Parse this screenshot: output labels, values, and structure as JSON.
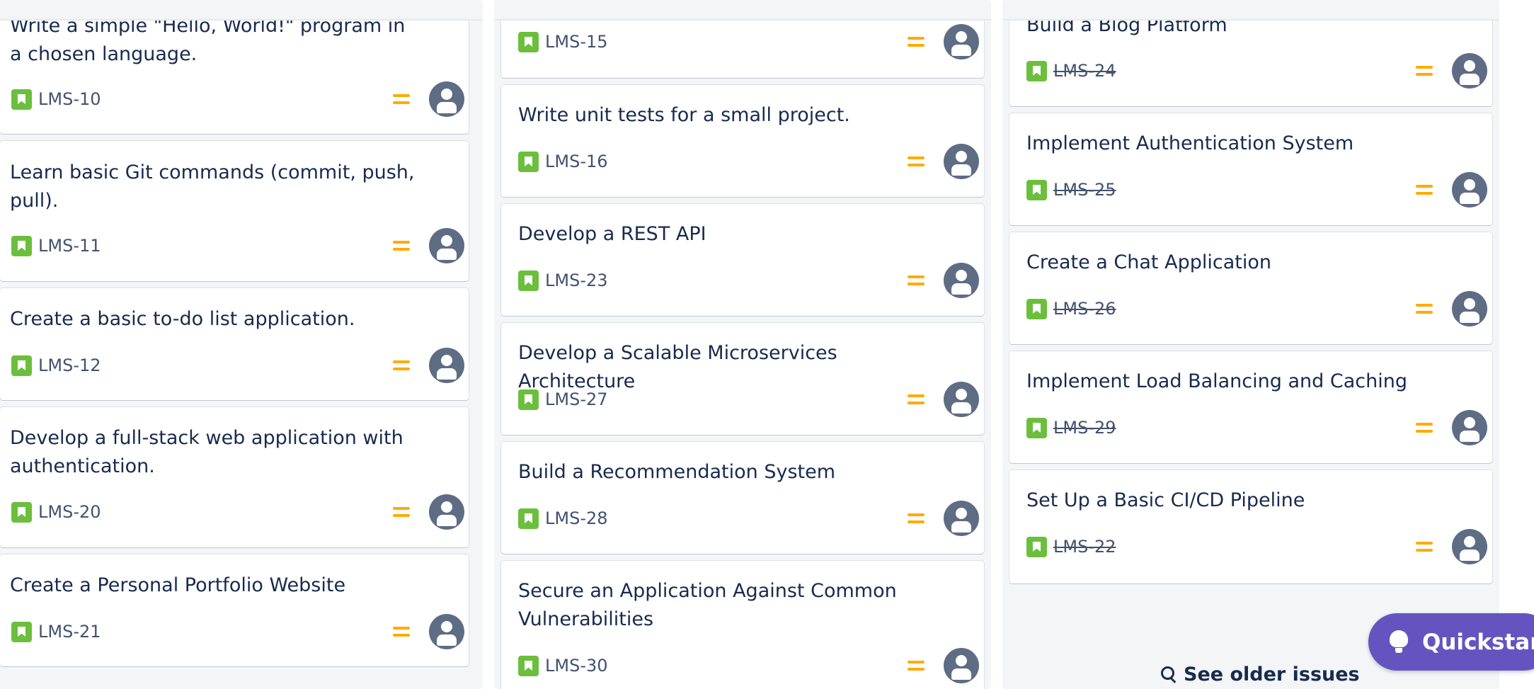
{
  "columns": [
    {
      "cards": [
        {
          "title": "Write a simple \"Hello, World!\" program in a chosen language.",
          "key": "LMS-10"
        },
        {
          "title": "Learn basic Git commands (commit, push, pull).",
          "key": "LMS-11"
        },
        {
          "title": "Create a basic to-do list application.",
          "key": "LMS-12"
        },
        {
          "title": "Develop a full-stack web application with authentication.",
          "key": "LMS-20"
        },
        {
          "title": "Create a Personal Portfolio Website",
          "key": "LMS-21"
        }
      ]
    },
    {
      "cards": [
        {
          "title": "",
          "key": "LMS-15"
        },
        {
          "title": "Write unit tests for a small project.",
          "key": "LMS-16"
        },
        {
          "title": "Develop a REST API",
          "key": "LMS-23"
        },
        {
          "title": "Develop a Scalable Microservices Architecture",
          "key": "LMS-27"
        },
        {
          "title": "Build a Recommendation System",
          "key": "LMS-28"
        },
        {
          "title": "Secure an Application Against Common Vulnerabilities",
          "key": "LMS-30"
        }
      ]
    },
    {
      "cards": [
        {
          "title": "Build a Blog Platform",
          "key": "LMS-24"
        },
        {
          "title": "Implement Authentication System",
          "key": "LMS-25"
        },
        {
          "title": "Create a Chat Application",
          "key": "LMS-26"
        },
        {
          "title": "Implement Load Balancing and Caching",
          "key": "LMS-29"
        },
        {
          "title": "Set Up a Basic CI/CD Pipeline",
          "key": "LMS-22"
        }
      ]
    }
  ],
  "see_older_label": "See older issues",
  "quickstart_label": "Quickstart",
  "colors": {
    "story": "#6bbf3c",
    "priority_medium": "#ffab00",
    "avatar": "#5e6c84",
    "quickstart": "#6554c0",
    "column_bg": "#f4f5f7"
  },
  "icons": {
    "issue_type": "story-icon",
    "priority": "priority-medium-icon",
    "assignee": "unassigned-avatar-icon",
    "search": "search-icon",
    "quickstart": "lightbulb-icon"
  }
}
